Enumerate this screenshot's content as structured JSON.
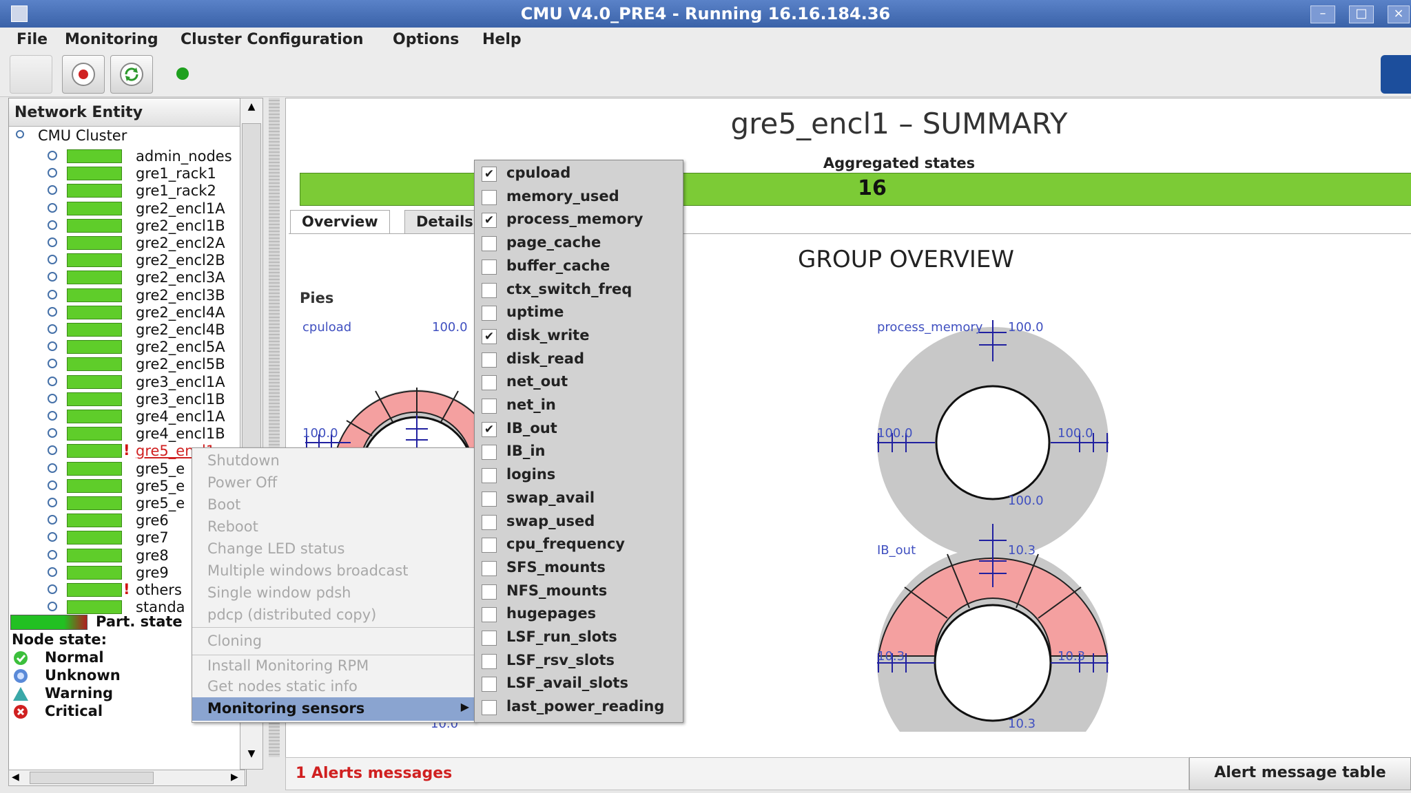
{
  "window": {
    "title": "CMU V4.0_PRE4 - Running 16.16.184.36"
  },
  "menubar": {
    "file": "File",
    "monitoring": "Monitoring",
    "cluster_config": "Cluster Configuration",
    "options": "Options",
    "help": "Help"
  },
  "left_panel": {
    "header": "Network Entity",
    "root": "CMU Cluster",
    "groups": [
      {
        "label": "admin_nodes",
        "alert": false
      },
      {
        "label": "gre1_rack1",
        "alert": false
      },
      {
        "label": "gre1_rack2",
        "alert": false
      },
      {
        "label": "gre2_encl1A",
        "alert": false
      },
      {
        "label": "gre2_encl1B",
        "alert": false
      },
      {
        "label": "gre2_encl2A",
        "alert": false
      },
      {
        "label": "gre2_encl2B",
        "alert": false
      },
      {
        "label": "gre2_encl3A",
        "alert": false
      },
      {
        "label": "gre2_encl3B",
        "alert": false
      },
      {
        "label": "gre2_encl4A",
        "alert": false
      },
      {
        "label": "gre2_encl4B",
        "alert": false
      },
      {
        "label": "gre2_encl5A",
        "alert": false
      },
      {
        "label": "gre2_encl5B",
        "alert": false
      },
      {
        "label": "gre3_encl1A",
        "alert": false
      },
      {
        "label": "gre3_encl1B",
        "alert": false
      },
      {
        "label": "gre4_encl1A",
        "alert": false
      },
      {
        "label": "gre4_encl1B",
        "alert": false
      },
      {
        "label": "gre5_encl1",
        "alert": true
      },
      {
        "label": "gre5_e",
        "alert": false
      },
      {
        "label": "gre5_e",
        "alert": false
      },
      {
        "label": "gre5_e",
        "alert": false
      },
      {
        "label": "gre6",
        "alert": false
      },
      {
        "label": "gre7",
        "alert": false
      },
      {
        "label": "gre8",
        "alert": false
      },
      {
        "label": "gre9",
        "alert": false
      },
      {
        "label": "others",
        "alert": true
      },
      {
        "label": "standa",
        "alert": false
      }
    ],
    "part_state": "Part. state",
    "node_state_title": "Node state:",
    "states": {
      "normal": "Normal",
      "unknown": "Unknown",
      "warning": "Warning",
      "critical": "Critical"
    }
  },
  "main": {
    "title": "gre5_encl1 – SUMMARY",
    "aggregated_label": "Aggregated states",
    "aggregated_value": "16",
    "tabs": {
      "overview": "Overview",
      "details": "Details"
    },
    "group_overview": "GROUP OVERVIEW",
    "pies_label": "Pies",
    "pies": {
      "cpuload": {
        "name": "cpuload",
        "top": "100.0",
        "left": "100.0"
      },
      "process_memory": {
        "name": "process_memory",
        "top": "100.0",
        "left": "100.0",
        "right": "100.0",
        "bottom": "100.0"
      },
      "ib_out": {
        "name": "IB_out",
        "top": "10.3",
        "left": "10.3",
        "right": "10.3",
        "bottom": "10.3"
      },
      "hidden_bottom": "10.0"
    },
    "alerts": "1 Alerts messages",
    "alert_table_button": "Alert message table"
  },
  "context_menu": {
    "items": [
      "Shutdown",
      "Power Off",
      "Boot",
      "Reboot",
      "Change LED status",
      "Multiple windows broadcast",
      "Single window pdsh",
      "pdcp (distributed copy)"
    ],
    "cloning": "Cloning",
    "rpm": "Install Monitoring RPM",
    "static_info": "Get nodes static info",
    "monitoring_sensors": "Monitoring sensors"
  },
  "sensors_submenu": [
    {
      "label": "cpuload",
      "checked": true
    },
    {
      "label": "memory_used",
      "checked": false
    },
    {
      "label": "process_memory",
      "checked": true
    },
    {
      "label": "page_cache",
      "checked": false
    },
    {
      "label": "buffer_cache",
      "checked": false
    },
    {
      "label": "ctx_switch_freq",
      "checked": false
    },
    {
      "label": "uptime",
      "checked": false
    },
    {
      "label": "disk_write",
      "checked": true
    },
    {
      "label": "disk_read",
      "checked": false
    },
    {
      "label": "net_out",
      "checked": false
    },
    {
      "label": "net_in",
      "checked": false
    },
    {
      "label": "IB_out",
      "checked": true
    },
    {
      "label": "IB_in",
      "checked": false
    },
    {
      "label": "logins",
      "checked": false
    },
    {
      "label": "swap_avail",
      "checked": false
    },
    {
      "label": "swap_used",
      "checked": false
    },
    {
      "label": "cpu_frequency",
      "checked": false
    },
    {
      "label": "SFS_mounts",
      "checked": false
    },
    {
      "label": "NFS_mounts",
      "checked": false
    },
    {
      "label": "hugepages",
      "checked": false
    },
    {
      "label": "LSF_run_slots",
      "checked": false
    },
    {
      "label": "LSF_rsv_slots",
      "checked": false
    },
    {
      "label": "LSF_avail_slots",
      "checked": false
    },
    {
      "label": "last_power_reading",
      "checked": false
    }
  ],
  "colors": {
    "green": "#5fcd2a",
    "pink": "#f4a0a0",
    "grey_ring": "#c8c8c8",
    "blue_label": "#4050c0",
    "alert_red": "#d02020",
    "title_blue": "#3a62a8"
  },
  "check_glyph": "✔"
}
